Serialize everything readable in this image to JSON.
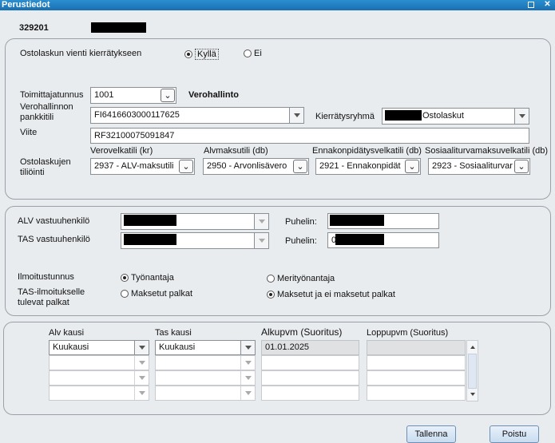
{
  "window": {
    "title": "Perustiedot"
  },
  "header": {
    "code": "329201"
  },
  "settings": {
    "recycle_label": "Ostolaskun vienti kierrätykseen",
    "yes_label": "Kyllä",
    "no_label": "Ei",
    "recycle_selected": "yes",
    "supplier_label": "Toimittajatunnus",
    "supplier_value": "1001",
    "supplier_name": "Verohallinto",
    "bank_label": "Verohallinnon pankkitili",
    "bank_value": "FI6416603000117625",
    "ref_label": "Viite",
    "ref_value": "RF32100075091847",
    "group_label": "Kierrätysryhmä",
    "group_value": "Ostolaskut",
    "accounting_label": "Ostolaskujen tiliöinti",
    "accounts": [
      {
        "header": "Verovelkatili (kr)",
        "value": "2937 - ALV-maksutili"
      },
      {
        "header": "Alvmaksutili (db)",
        "value": "2950 - Arvonlisävero"
      },
      {
        "header": "Ennakonpidätysvelkatili (db)",
        "value": "2921 - Ennakonpidät"
      },
      {
        "header": "Sosiaaliturvamaksuvelkatili (db)",
        "value": "2923 - Sosiaaliturvar"
      }
    ]
  },
  "contacts": {
    "alv_label": "ALV vastuuhenkilö",
    "tas_label": "TAS vastuuhenkilö",
    "phone_label": "Puhelin:",
    "tas_phone_prefix": "0",
    "notify_label": "Ilmoitustunnus",
    "employer_label": "Työnantaja",
    "seafarer_label": "Merityönantaja",
    "notify_selected": "employer",
    "tas_notice_label": "TAS-ilmoitukselle tulevat palkat",
    "paid_label": "Maksetut palkat",
    "paid_unpaid_label": "Maksetut ja ei maksetut palkat",
    "tas_notice_selected": "paid_unpaid"
  },
  "periods": {
    "headers": [
      "Alv kausi",
      "Tas kausi",
      "Alkupvm (Suoritus)",
      "Loppupvm (Suoritus)"
    ],
    "rows": [
      {
        "alv": "Kuukausi",
        "tas": "Kuukausi",
        "start": "01.01.2025",
        "end": ""
      },
      {
        "alv": "",
        "tas": "",
        "start": "",
        "end": ""
      },
      {
        "alv": "",
        "tas": "",
        "start": "",
        "end": ""
      },
      {
        "alv": "",
        "tas": "",
        "start": "",
        "end": ""
      }
    ]
  },
  "footer": {
    "save_label": "Tallenna",
    "exit_label": "Poistu"
  },
  "colors": {
    "titlebar": "#1a6fb0",
    "panel_bg": "#e9ecef",
    "button": "#c9dcef"
  }
}
